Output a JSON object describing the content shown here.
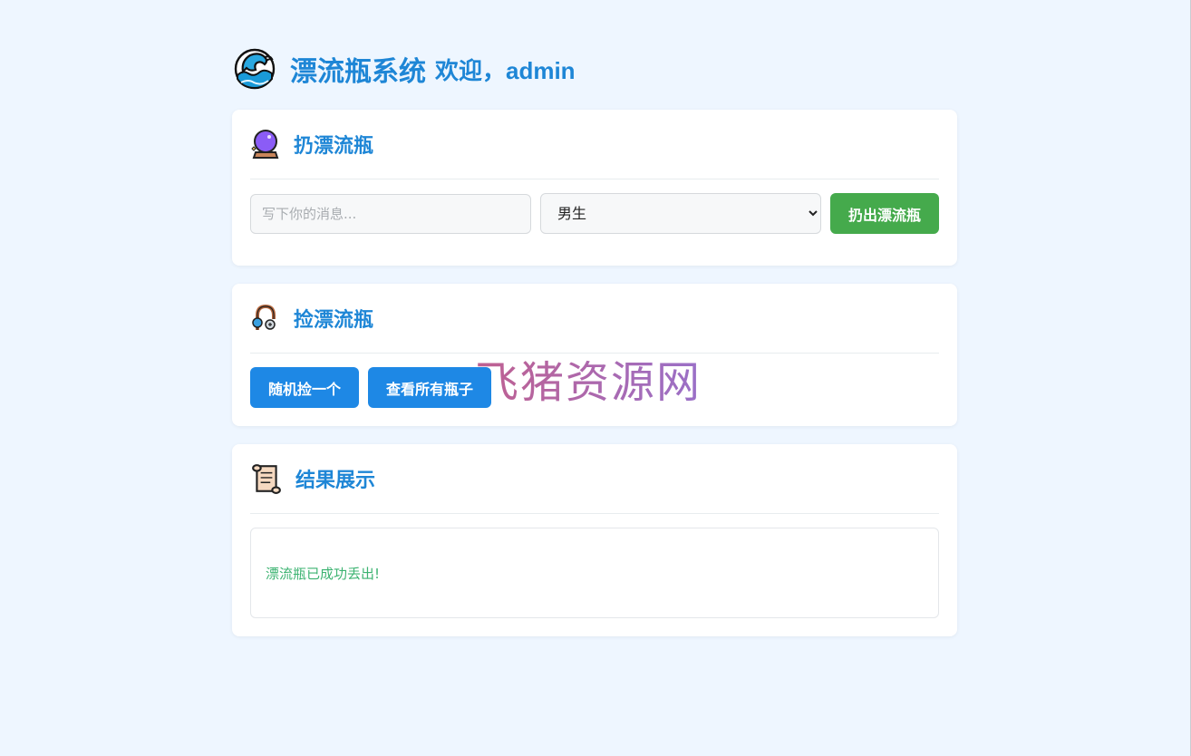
{
  "header": {
    "title": "漂流瓶系统",
    "welcome": "欢迎，admin",
    "logo_icon": "wave-icon"
  },
  "throw_card": {
    "title": "扔漂流瓶",
    "icon": "crystal-ball-icon",
    "message_placeholder": "写下你的消息...",
    "message_value": "",
    "gender_selected": "男生",
    "throw_button": "扔出漂流瓶"
  },
  "pick_card": {
    "title": "捡漂流瓶",
    "icon": "fishing-hook-icon",
    "random_button": "随机捡一个",
    "view_all_button": "查看所有瓶子"
  },
  "result_card": {
    "title": "结果展示",
    "icon": "scroll-icon",
    "message": "漂流瓶已成功丢出!"
  },
  "watermark": "飞猪资源网",
  "colors": {
    "accent": "#1e86d6",
    "background": "#eef6ff",
    "green_button": "#45aa4c",
    "blue_button": "#1e88e5",
    "success_text": "#3cb371"
  }
}
